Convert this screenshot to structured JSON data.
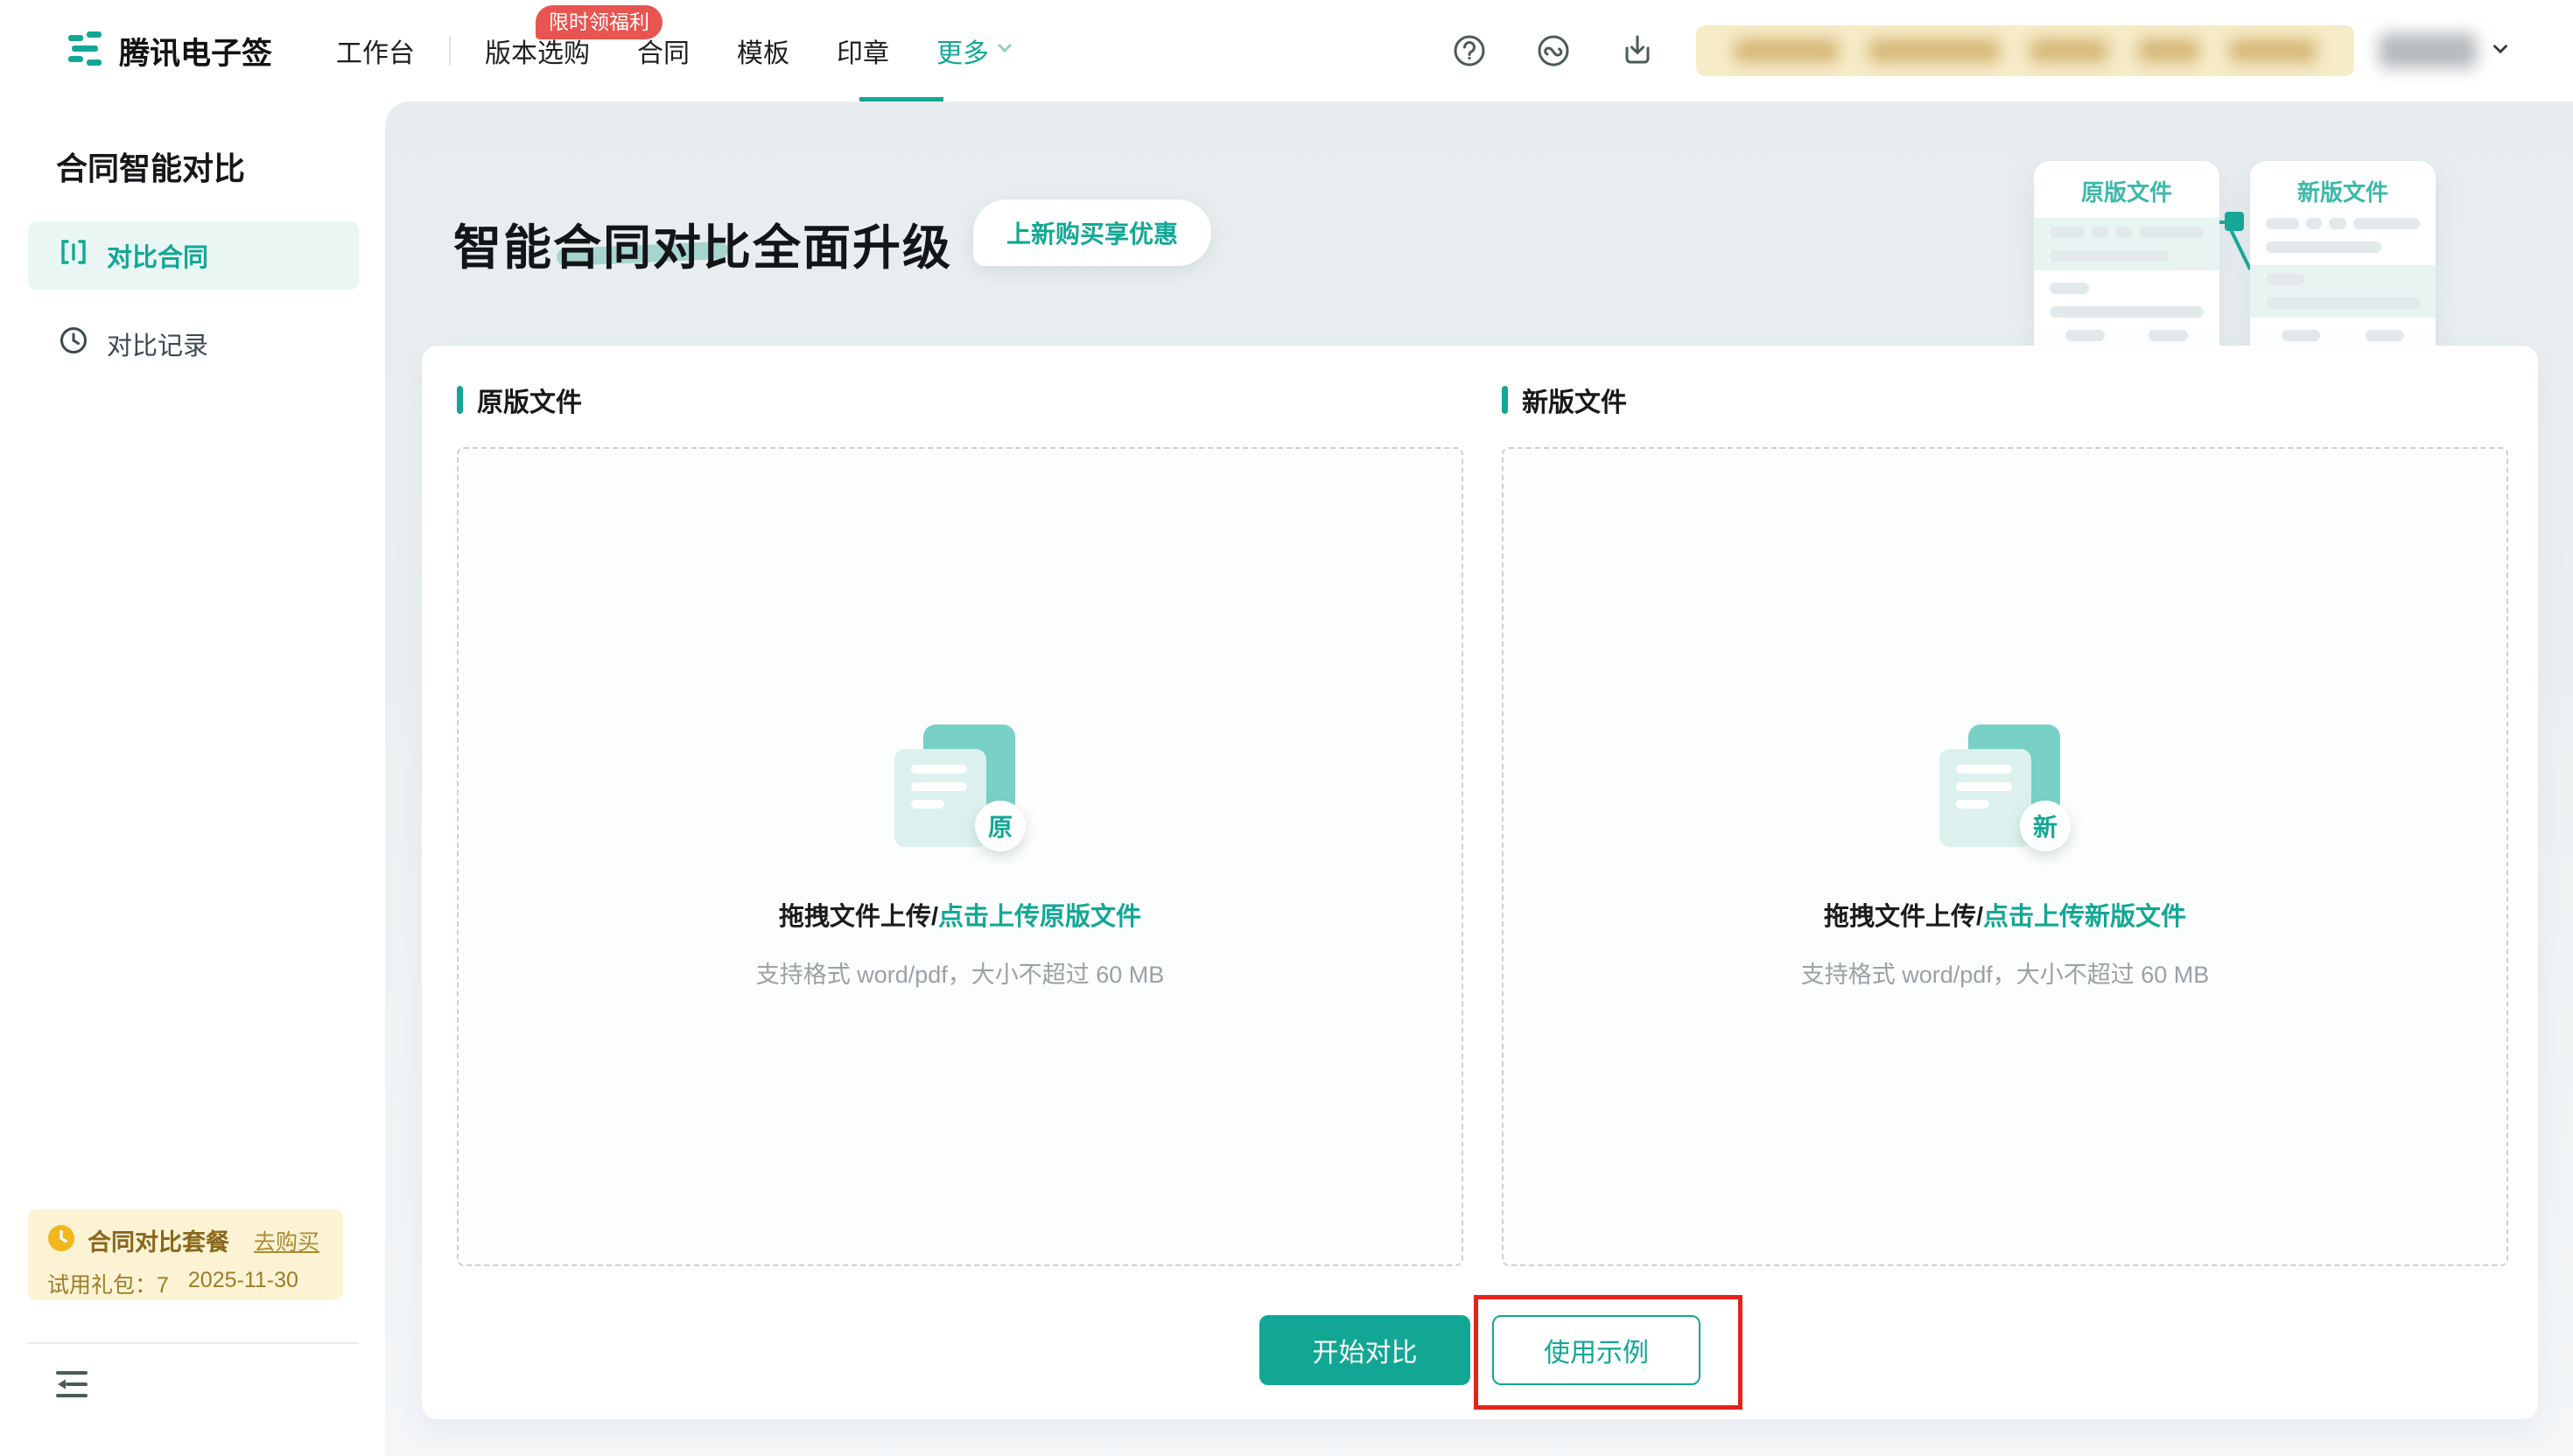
{
  "nav": {
    "brand": "腾讯电子签",
    "items": [
      {
        "label": "工作台"
      },
      {
        "label": "版本选购",
        "badge": "限时领福利"
      },
      {
        "label": "合同"
      },
      {
        "label": "模板"
      },
      {
        "label": "印章"
      },
      {
        "label": "更多",
        "active": true
      }
    ]
  },
  "sidebar": {
    "title": "合同智能对比",
    "items": [
      {
        "label": "对比合同",
        "active": true
      },
      {
        "label": "对比记录"
      }
    ],
    "package": {
      "title": "合同对比套餐",
      "link": "去购买",
      "trial": "试用礼包：7",
      "expiry": "2025-11-30"
    }
  },
  "hero": {
    "title": "智能合同对比全面升级",
    "pill": "上新购买享优惠",
    "illustration": {
      "left": "原版文件",
      "right": "新版文件"
    }
  },
  "panels": [
    {
      "label": "原版文件",
      "badge": "原",
      "drag": "拖拽文件上传/",
      "link": "点击上传原版文件",
      "hint": "支持格式 word/pdf，大小不超过 60 MB"
    },
    {
      "label": "新版文件",
      "badge": "新",
      "drag": "拖拽文件上传/",
      "link": "点击上传新版文件",
      "hint": "支持格式 word/pdf，大小不超过 60 MB"
    }
  ],
  "actions": {
    "start": "开始对比",
    "example": "使用示例"
  },
  "colors": {
    "accent": "#12a795",
    "badge_red": "#e8544f",
    "annotation_red": "#e3231a",
    "package_bg": "#fbf3d4"
  }
}
